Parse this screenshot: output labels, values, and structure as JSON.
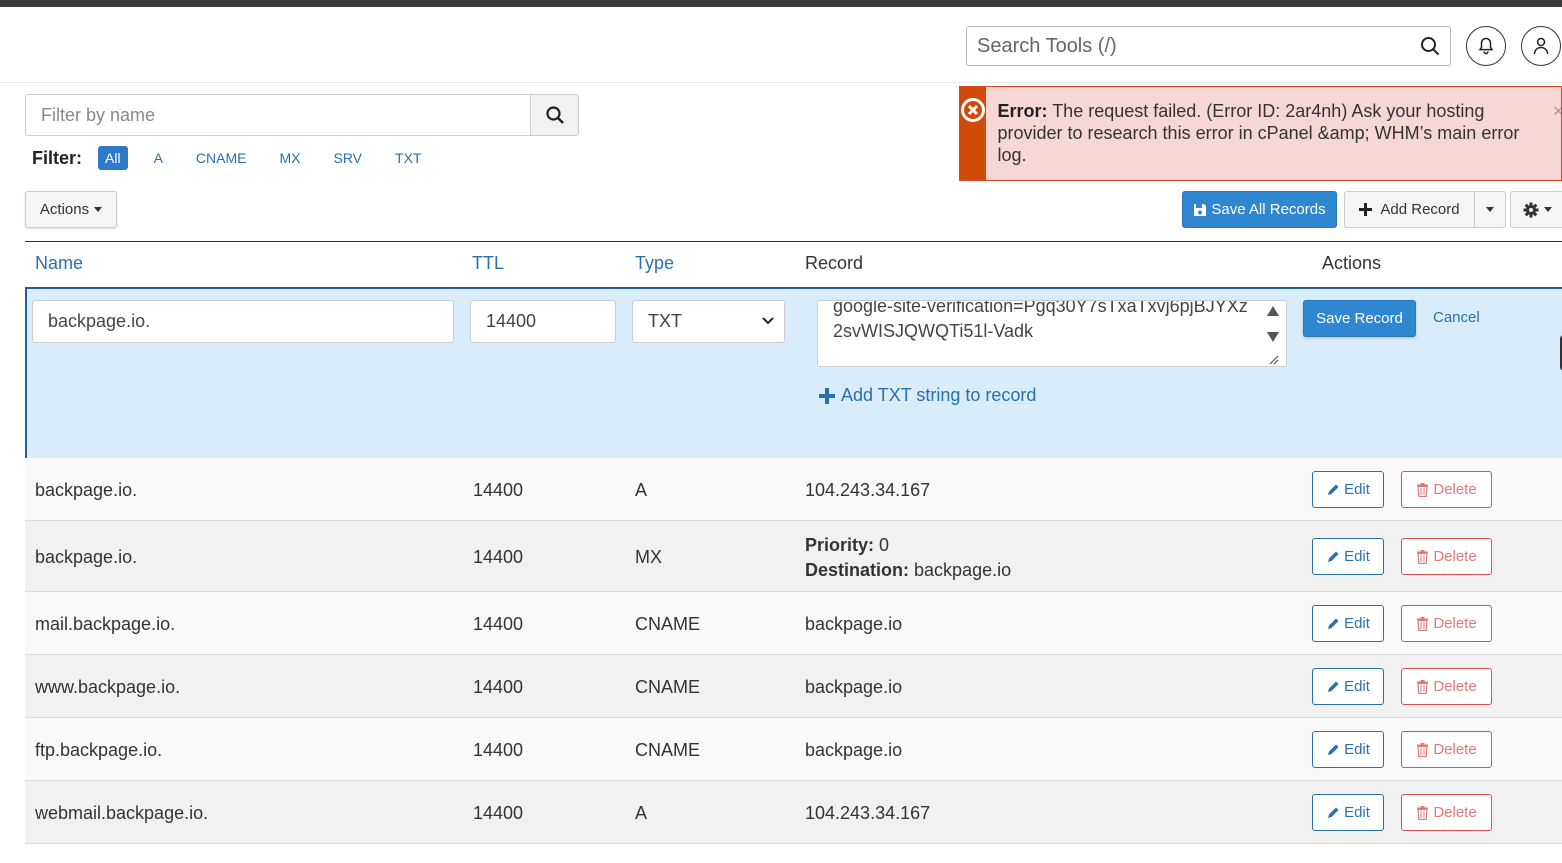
{
  "header": {
    "search_placeholder": "Search Tools (/)"
  },
  "filter": {
    "placeholder": "Filter by name",
    "label": "Filter:",
    "chips": [
      "All",
      "A",
      "CNAME",
      "MX",
      "SRV",
      "TXT"
    ],
    "active": "All"
  },
  "error": {
    "title": "Error:",
    "message": "The request failed. (Error ID: 2ar4nh) Ask your hosting provider to research this error in cPanel &amp; WHM’s main error log.",
    "close": "×"
  },
  "toolbar": {
    "actions_label": "Actions",
    "save_all_label": "Save All Records",
    "add_record_label": "Add Record"
  },
  "table": {
    "headers": {
      "name": "Name",
      "ttl": "TTL",
      "type": "Type",
      "record": "Record",
      "actions": "Actions"
    }
  },
  "edit_row": {
    "name": "backpage.io.",
    "ttl": "14400",
    "type": "TXT",
    "record": "google-site-verification=Pgq30Y7sTxaTxvj6pjBJYXz2svWISJQWQTi51l-Vadk",
    "add_txt_label": "Add TXT string to record",
    "save_label": "Save Record",
    "cancel_label": "Cancel"
  },
  "rows": [
    {
      "name": "backpage.io.",
      "ttl": "14400",
      "type": "A",
      "record": "104.243.34.167"
    },
    {
      "name": "backpage.io.",
      "ttl": "14400",
      "type": "MX",
      "priority_label": "Priority:",
      "priority": "0",
      "destination_label": "Destination:",
      "destination": "backpage.io"
    },
    {
      "name": "mail.backpage.io.",
      "ttl": "14400",
      "type": "CNAME",
      "record": "backpage.io"
    },
    {
      "name": "www.backpage.io.",
      "ttl": "14400",
      "type": "CNAME",
      "record": "backpage.io"
    },
    {
      "name": "ftp.backpage.io.",
      "ttl": "14400",
      "type": "CNAME",
      "record": "backpage.io"
    },
    {
      "name": "webmail.backpage.io.",
      "ttl": "14400",
      "type": "A",
      "record": "104.243.34.167"
    }
  ],
  "row_actions": {
    "edit_label": "Edit",
    "delete_label": "Delete"
  },
  "colors": {
    "primary": "#2f86d1",
    "link": "#2a6fb0",
    "error_bar": "#d24a0a",
    "error_bg": "#f7d6d6",
    "edit_row_bg": "#d9ecfa",
    "danger": "#d9534f"
  }
}
